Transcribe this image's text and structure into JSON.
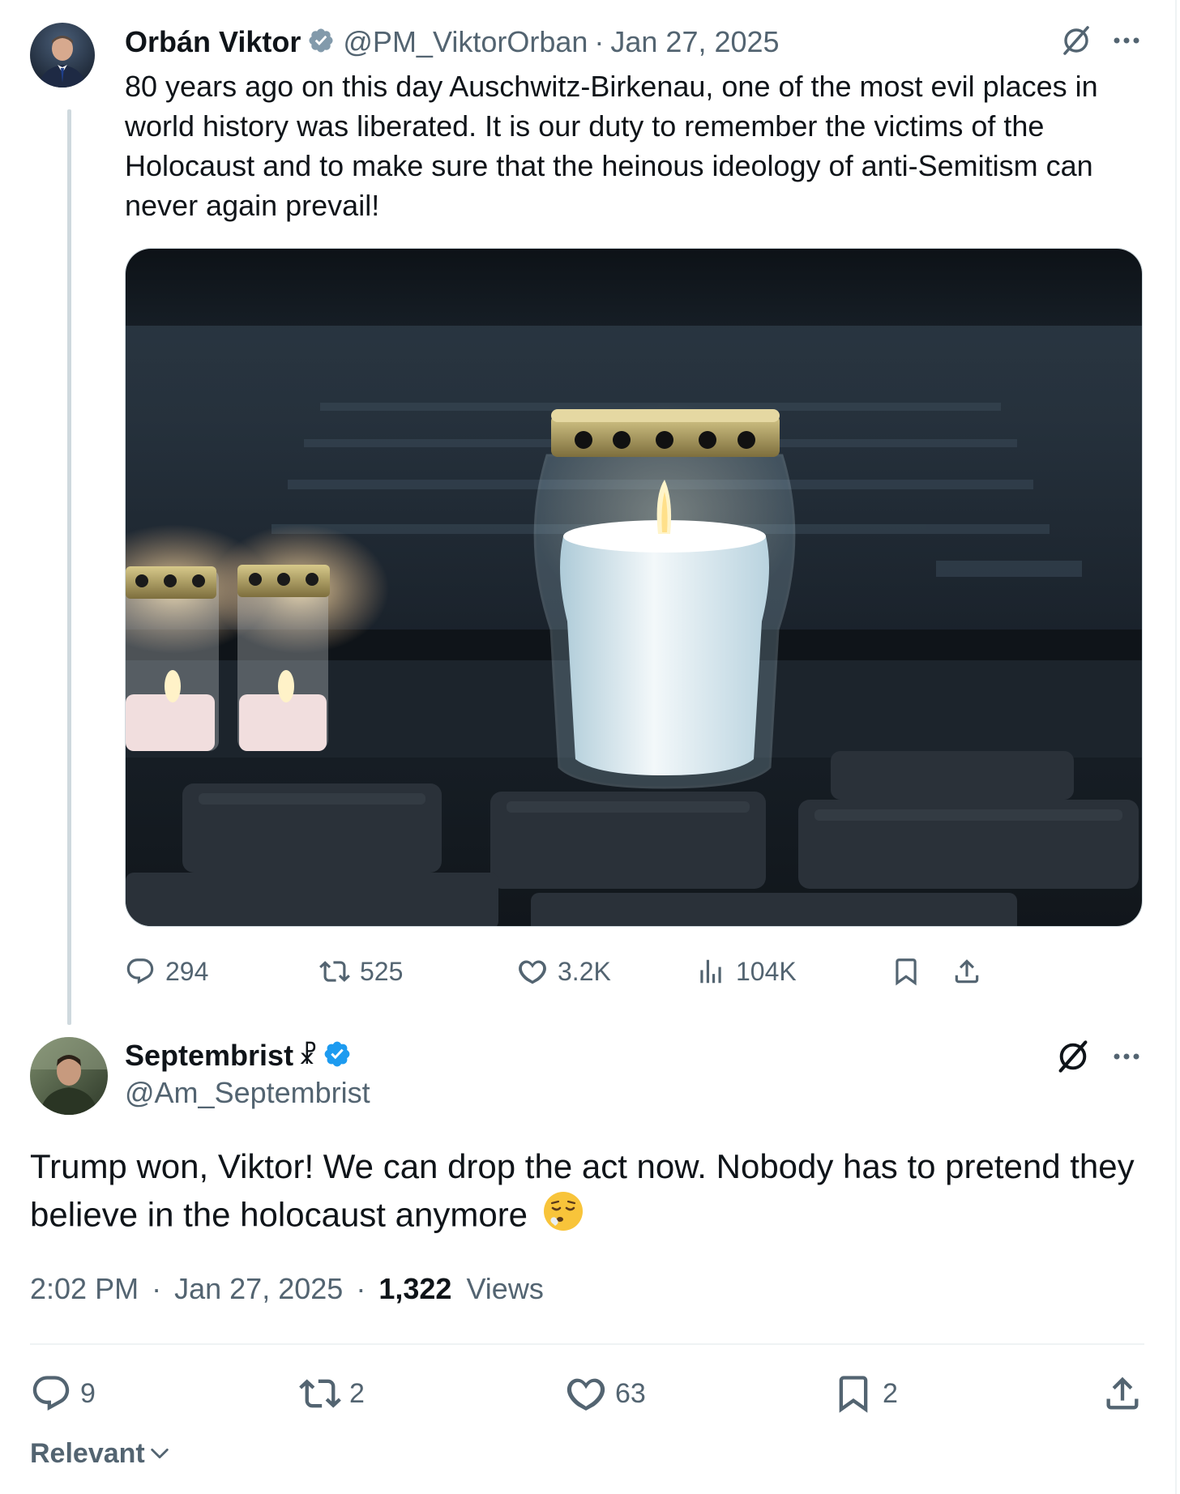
{
  "parent": {
    "author_name": "Orbán Viktor",
    "handle": "@PM_ViktorOrban",
    "separator": "·",
    "date": "Jan 27, 2025",
    "text": "80 years ago on this day Auschwitz-Birkenau, one of the most evil places in world history was liberated. It is our duty to remember the victims of the Holocaust and to make sure that the heinous ideology of anti-Semitism can never again prevail!",
    "stats": {
      "replies": "294",
      "reposts": "525",
      "likes": "3.2K",
      "views": "104K"
    }
  },
  "reply": {
    "author_name": "Septembrist",
    "name_symbol": "☧",
    "handle": "@Am_Septembrist",
    "text": "Trump won, Viktor! We can drop the act now. Nobody has to pretend they believe in the holocaust anymore",
    "emoji": "😮‍💨",
    "time": "2:02 PM",
    "separator": "·",
    "date": "Jan 27, 2025",
    "views_count": "1,322",
    "views_label": "Views",
    "stats": {
      "replies": "9",
      "reposts": "2",
      "likes": "63",
      "bookmarks": "2"
    }
  },
  "sort": {
    "label": "Relevant"
  },
  "colors": {
    "verified_blue": "#1d9bf0",
    "verified_gray": "#829aab",
    "muted_text": "#536471",
    "primary_text": "#0f1419"
  },
  "icons": [
    "verified-badge-icon",
    "grok-icon",
    "more-icon",
    "reply-icon",
    "repost-icon",
    "like-icon",
    "views-icon",
    "bookmark-icon",
    "share-icon",
    "chevron-down-icon"
  ]
}
